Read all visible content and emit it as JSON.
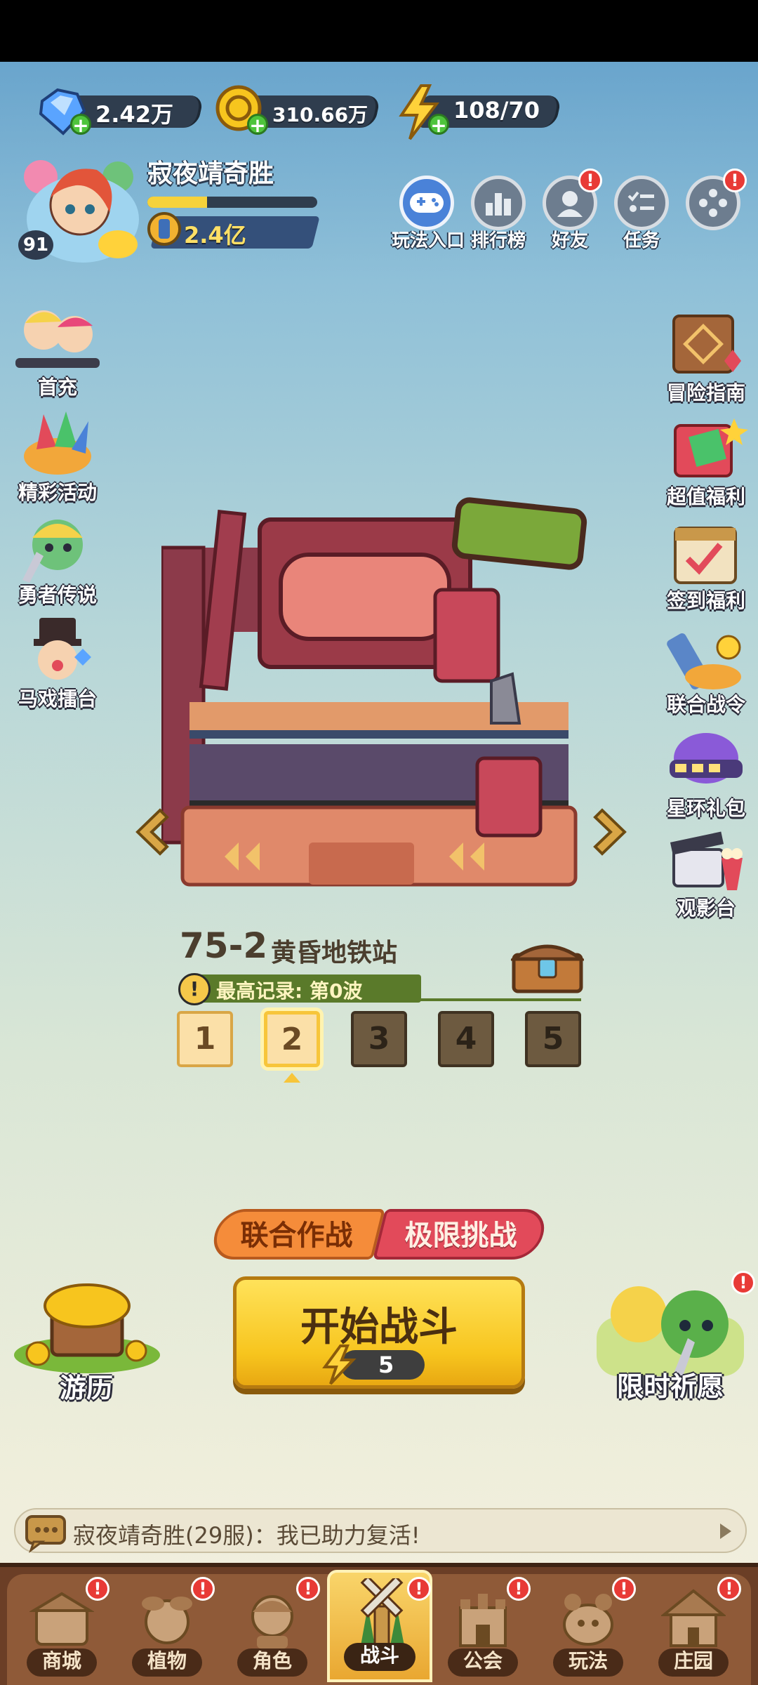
{
  "currencies": [
    {
      "name": "diamond",
      "value": "2.42万"
    },
    {
      "name": "coin",
      "value": "310.66万"
    },
    {
      "name": "energy",
      "value": "108/70"
    }
  ],
  "player": {
    "name": "寂夜靖奇胜",
    "level": "91",
    "power": "2.4亿",
    "xp_fraction": 0.35
  },
  "top_buttons": [
    {
      "label": "玩法入口",
      "icon": "gamepad-icon",
      "notify": false
    },
    {
      "label": "排行榜",
      "icon": "leaderboard-icon",
      "notify": false
    },
    {
      "label": "好友",
      "icon": "friend-icon",
      "notify": true
    },
    {
      "label": "任务",
      "icon": "task-list-icon",
      "notify": false
    },
    {
      "label": "",
      "icon": "more-icon",
      "notify": true
    }
  ],
  "left_menu": [
    {
      "label": "首充"
    },
    {
      "label": "精彩活动"
    },
    {
      "label": "勇者传说"
    },
    {
      "label": "马戏擂台"
    }
  ],
  "right_menu": [
    {
      "label": "冒险指南"
    },
    {
      "label": "超值福利"
    },
    {
      "label": "签到福利"
    },
    {
      "label": "联合战令"
    },
    {
      "label": "星环礼包"
    },
    {
      "label": "观影台"
    }
  ],
  "stage": {
    "code": "75-2",
    "name": "黄昏地铁站",
    "record": "最高记录: 第0波",
    "info_icon": "!",
    "waves": [
      "1",
      "2",
      "3",
      "4",
      "5"
    ],
    "current_wave": 2
  },
  "modes": {
    "co_op": "联合作战",
    "extreme": "极限挑战"
  },
  "start": {
    "label": "开始战斗",
    "cost": "5"
  },
  "corner": {
    "left_label": "游历",
    "right_label": "限时祈愿"
  },
  "chat": {
    "message": "寂夜靖奇胜(29服)：我已助力复活!"
  },
  "nav": [
    {
      "label": "商城",
      "notify": true
    },
    {
      "label": "植物",
      "notify": true
    },
    {
      "label": "角色",
      "notify": true
    },
    {
      "label": "战斗",
      "notify": true,
      "active": true
    },
    {
      "label": "公会",
      "notify": true
    },
    {
      "label": "玩法",
      "notify": true
    },
    {
      "label": "庄园",
      "notify": true
    }
  ],
  "notify_mark": "!",
  "colors": {
    "accent_yellow": "#f7c51e",
    "notify_red": "#e83a36",
    "co_op_orange": "#f58c3a",
    "extreme_red": "#e24a5a",
    "nav_brown": "#6b3e26"
  }
}
